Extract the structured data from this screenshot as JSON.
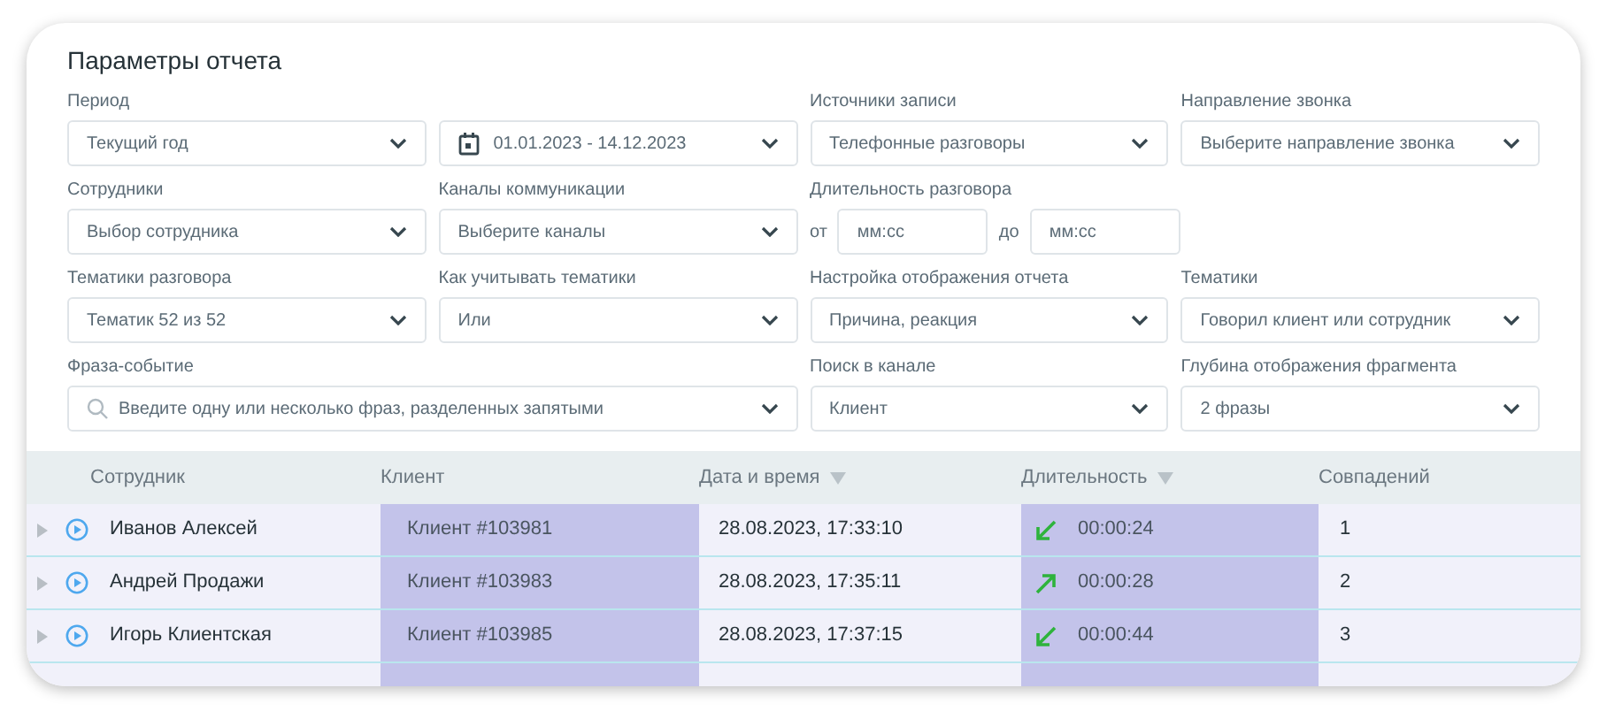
{
  "title": "Параметры отчета",
  "filters": [
    {
      "kind": "select",
      "label": "Период",
      "value": "Текущий год"
    },
    {
      "kind": "date",
      "value": "01.01.2023 - 14.12.2023"
    },
    {
      "kind": "select",
      "label": "Источники записи",
      "value": "Телефонные разговоры"
    },
    {
      "kind": "select",
      "label": "Направление звонка",
      "value": "Выберите направление звонка"
    },
    {
      "kind": "select",
      "label": "Сотрудники",
      "value": "Выбор сотрудника"
    },
    {
      "kind": "select",
      "label": "Каналы коммуникации",
      "value": "Выберите каналы"
    },
    {
      "kind": "range",
      "label": "Длительность разговора",
      "from_label": "от",
      "from_placeholder": "мм:сс",
      "to_label": "до",
      "to_placeholder": "мм:сс"
    },
    {
      "kind": "empty"
    },
    {
      "kind": "select",
      "label": "Тематики разговора",
      "value": "Тематик 52 из 52"
    },
    {
      "kind": "select",
      "label": "Как учитывать тематики",
      "value": "Или"
    },
    {
      "kind": "select",
      "label": "Настройка отображения отчета",
      "value": "Причина, реакция"
    },
    {
      "kind": "select",
      "label": "Тематики",
      "value": "Говорил клиент или сотрудник"
    },
    {
      "kind": "search",
      "label": "Фраза-событие",
      "placeholder": "Введите одну или несколько фраз, разделенных запятыми"
    },
    {
      "kind": "select",
      "label": "Поиск в канале",
      "value": "Клиент"
    },
    {
      "kind": "select",
      "label": "Глубина отображения фрагмента",
      "value": "2 фразы"
    }
  ],
  "table": {
    "columns": [
      {
        "label": "Сотрудник",
        "sortable": false
      },
      {
        "label": "Клиент",
        "sortable": false
      },
      {
        "label": "Дата и время",
        "sortable": true
      },
      {
        "label": "Длительность",
        "sortable": true
      },
      {
        "label": "Совпадений",
        "sortable": false
      }
    ],
    "rows": [
      {
        "employee": "Иванов Алексей",
        "client": "Клиент #103981",
        "datetime": "28.08.2023, 17:33:10",
        "kind": "incoming",
        "duration": "00:00:24",
        "matches": "1"
      },
      {
        "employee": "Андрей Продажи",
        "client": "Клиент #103983",
        "datetime": "28.08.2023, 17:35:11",
        "kind": "outgoing",
        "duration": "00:00:28",
        "matches": "2"
      },
      {
        "employee": "Игорь Клиентская",
        "client": "Клиент #103985",
        "datetime": "28.08.2023, 17:37:15",
        "kind": "incoming",
        "duration": "00:00:44",
        "matches": "3"
      }
    ]
  }
}
